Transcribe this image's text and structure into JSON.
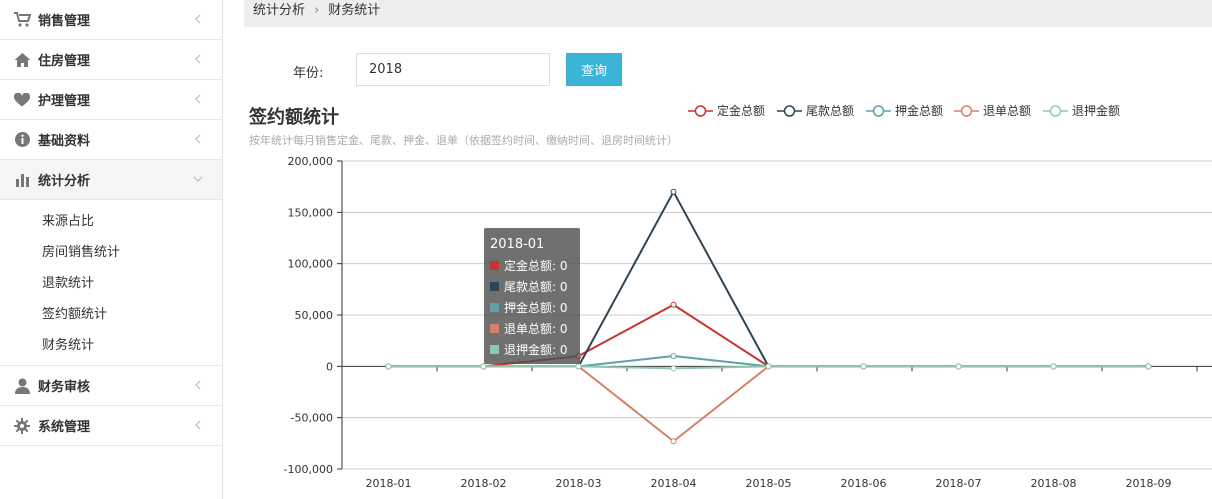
{
  "sidebar": {
    "items": [
      {
        "label": "销售管理",
        "icon": "cart-icon",
        "name": "sidebar-item-sales"
      },
      {
        "label": "住房管理",
        "icon": "home-icon",
        "name": "sidebar-item-housing"
      },
      {
        "label": "护理管理",
        "icon": "heart-icon",
        "name": "sidebar-item-nursing"
      },
      {
        "label": "基础资料",
        "icon": "info-icon",
        "name": "sidebar-item-basic"
      },
      {
        "label": "统计分析",
        "icon": "bar-chart-icon",
        "name": "sidebar-item-stats",
        "expanded": true,
        "children": [
          "来源占比",
          "房间销售统计",
          "退款统计",
          "签约额统计",
          "财务统计"
        ]
      },
      {
        "label": "财务审核",
        "icon": "user-icon",
        "name": "sidebar-item-finance-audit"
      },
      {
        "label": "系统管理",
        "icon": "gear-icon",
        "name": "sidebar-item-system"
      }
    ]
  },
  "breadcrumb": {
    "parent": "统计分析",
    "current": "财务统计"
  },
  "filter": {
    "year_label": "年份:",
    "year_value": "2018",
    "query_label": "查询"
  },
  "chart_data": {
    "type": "line",
    "title": "签约额统计",
    "subtitle": "按年统计每月销售定金、尾款、押金、退单（依据签约时间、缴纳时间、退房时间统计）",
    "categories": [
      "2018-01",
      "2018-02",
      "2018-03",
      "2018-04",
      "2018-05",
      "2018-06",
      "2018-07",
      "2018-08",
      "2018-09"
    ],
    "ylim": [
      -100000,
      200000
    ],
    "yticks": [
      "200,000",
      "150,000",
      "100,000",
      "50,000",
      "0",
      "-50,000",
      "-100,000"
    ],
    "series": [
      {
        "name": "定金总额",
        "color": "#c23531",
        "values": [
          0,
          0,
          10000,
          60000,
          0,
          0,
          0,
          0,
          0
        ]
      },
      {
        "name": "尾款总额",
        "color": "#2f4554",
        "values": [
          0,
          0,
          0,
          170000,
          0,
          0,
          0,
          0,
          0
        ]
      },
      {
        "name": "押金总额",
        "color": "#61a0a8",
        "values": [
          0,
          0,
          0,
          10000,
          0,
          0,
          0,
          0,
          0
        ]
      },
      {
        "name": "退单总额",
        "color": "#d48265",
        "values": [
          0,
          0,
          0,
          -73000,
          0,
          0,
          0,
          0,
          0
        ]
      },
      {
        "name": "退押金额",
        "color": "#91c7ae",
        "values": [
          0,
          0,
          0,
          -2000,
          0,
          0,
          0,
          0,
          0
        ]
      }
    ],
    "grid": true,
    "legend": "top-right",
    "tooltip": {
      "title": "2018-01",
      "items": [
        "定金总额: 0",
        "尾款总额: 0",
        "押金总额: 0",
        "退单总额: 0",
        "退押金额: 0"
      ]
    }
  }
}
